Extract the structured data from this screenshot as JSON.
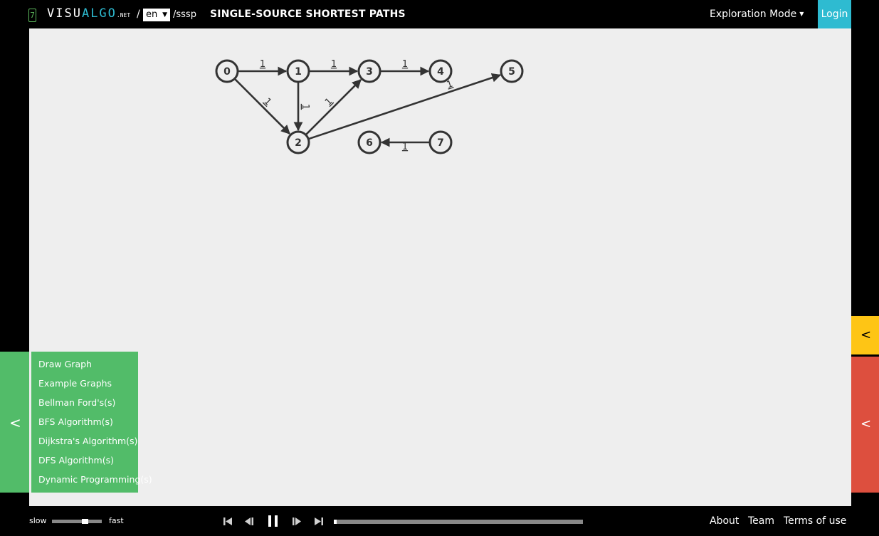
{
  "header": {
    "mode_number": "7",
    "logo_main": "VISU",
    "logo_accent": "ALGO",
    "logo_suffix": ".NET",
    "separator": "/",
    "language": "en",
    "path": "/sssp",
    "title": "SINGLE-SOURCE SHORTEST PATHS",
    "mode_label": "Exploration Mode",
    "login_label": "Login"
  },
  "graph": {
    "vertices": [
      {
        "id": "0",
        "label": "0"
      },
      {
        "id": "1",
        "label": "1"
      },
      {
        "id": "2",
        "label": "2"
      },
      {
        "id": "3",
        "label": "3"
      },
      {
        "id": "4",
        "label": "4"
      },
      {
        "id": "5",
        "label": "5"
      },
      {
        "id": "6",
        "label": "6"
      },
      {
        "id": "7",
        "label": "7"
      }
    ],
    "edges": [
      {
        "from": "0",
        "to": "1",
        "weight": "1"
      },
      {
        "from": "1",
        "to": "3",
        "weight": "1"
      },
      {
        "from": "3",
        "to": "4",
        "weight": "1"
      },
      {
        "from": "0",
        "to": "2",
        "weight": "1"
      },
      {
        "from": "1",
        "to": "2",
        "weight": "1"
      },
      {
        "from": "2",
        "to": "3",
        "weight": "1"
      },
      {
        "from": "2",
        "to": "5",
        "weight": "1"
      },
      {
        "from": "7",
        "to": "6",
        "weight": "1"
      }
    ]
  },
  "menu": {
    "items": [
      "Draw Graph",
      "Example Graphs",
      "Bellman Ford's(s)",
      "BFS Algorithm(s)",
      "Dijkstra's Algorithm(s)",
      "DFS Algorithm(s)",
      "Dynamic Programming(s)"
    ]
  },
  "footer": {
    "slow_label": "slow",
    "fast_label": "fast",
    "speed_fraction": 0.65,
    "progress_fraction": 0.01,
    "about_label": "About",
    "team_label": "Team",
    "terms_label": "Terms of use"
  },
  "colors": {
    "accent": "#2ebbd1",
    "menu_green": "#52bc69",
    "status_yellow": "#fec515",
    "codetrace_red": "#dd4f3e",
    "canvas_bg": "#eeeeee"
  },
  "icons": {
    "side_toggle": "chevron-left-icon",
    "status_toggle": "chevron-left-icon",
    "codetrace_toggle": "chevron-left-icon",
    "media": [
      "skip-to-start-icon",
      "step-backward-icon",
      "pause-icon",
      "step-forward-icon",
      "skip-to-end-icon"
    ]
  }
}
